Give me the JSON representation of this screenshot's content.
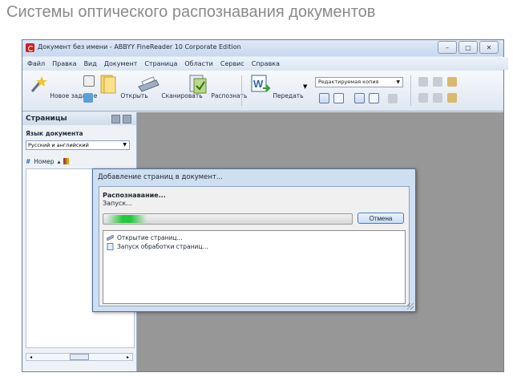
{
  "slide": {
    "title": "Системы оптического распознавания документов"
  },
  "window": {
    "title": "Документ без имени - ABBYY FineReader 10 Corporate Edition",
    "controls": {
      "minimize": "–",
      "maximize": "□",
      "close": "✕"
    }
  },
  "menu": [
    "Файл",
    "Правка",
    "Вид",
    "Документ",
    "Страница",
    "Области",
    "Сервис",
    "Справка"
  ],
  "toolbar": {
    "new_task": "Новое задание",
    "open": "Открыть",
    "scan": "Сканировать",
    "recognize": "Распознать",
    "send": "Передать",
    "format_select": "Редактируемая копия"
  },
  "pages_pane": {
    "title": "Страницы",
    "language_label": "Язык документа",
    "language_value": "Русский и английский",
    "number_column": "Номер",
    "scroll_left": "◂",
    "scroll_right": "▸"
  },
  "dialog": {
    "title": "Добавление страниц в документ...",
    "status": "Распознавание...",
    "substatus": "Запуск...",
    "cancel": "Отмена",
    "progress": 0.2,
    "log": [
      "Открытие страниц...",
      "Запуск обработки страниц..."
    ]
  },
  "colors": {
    "workarea": "#979797",
    "progress": "#26c83c",
    "logo": "#d11f1f"
  }
}
